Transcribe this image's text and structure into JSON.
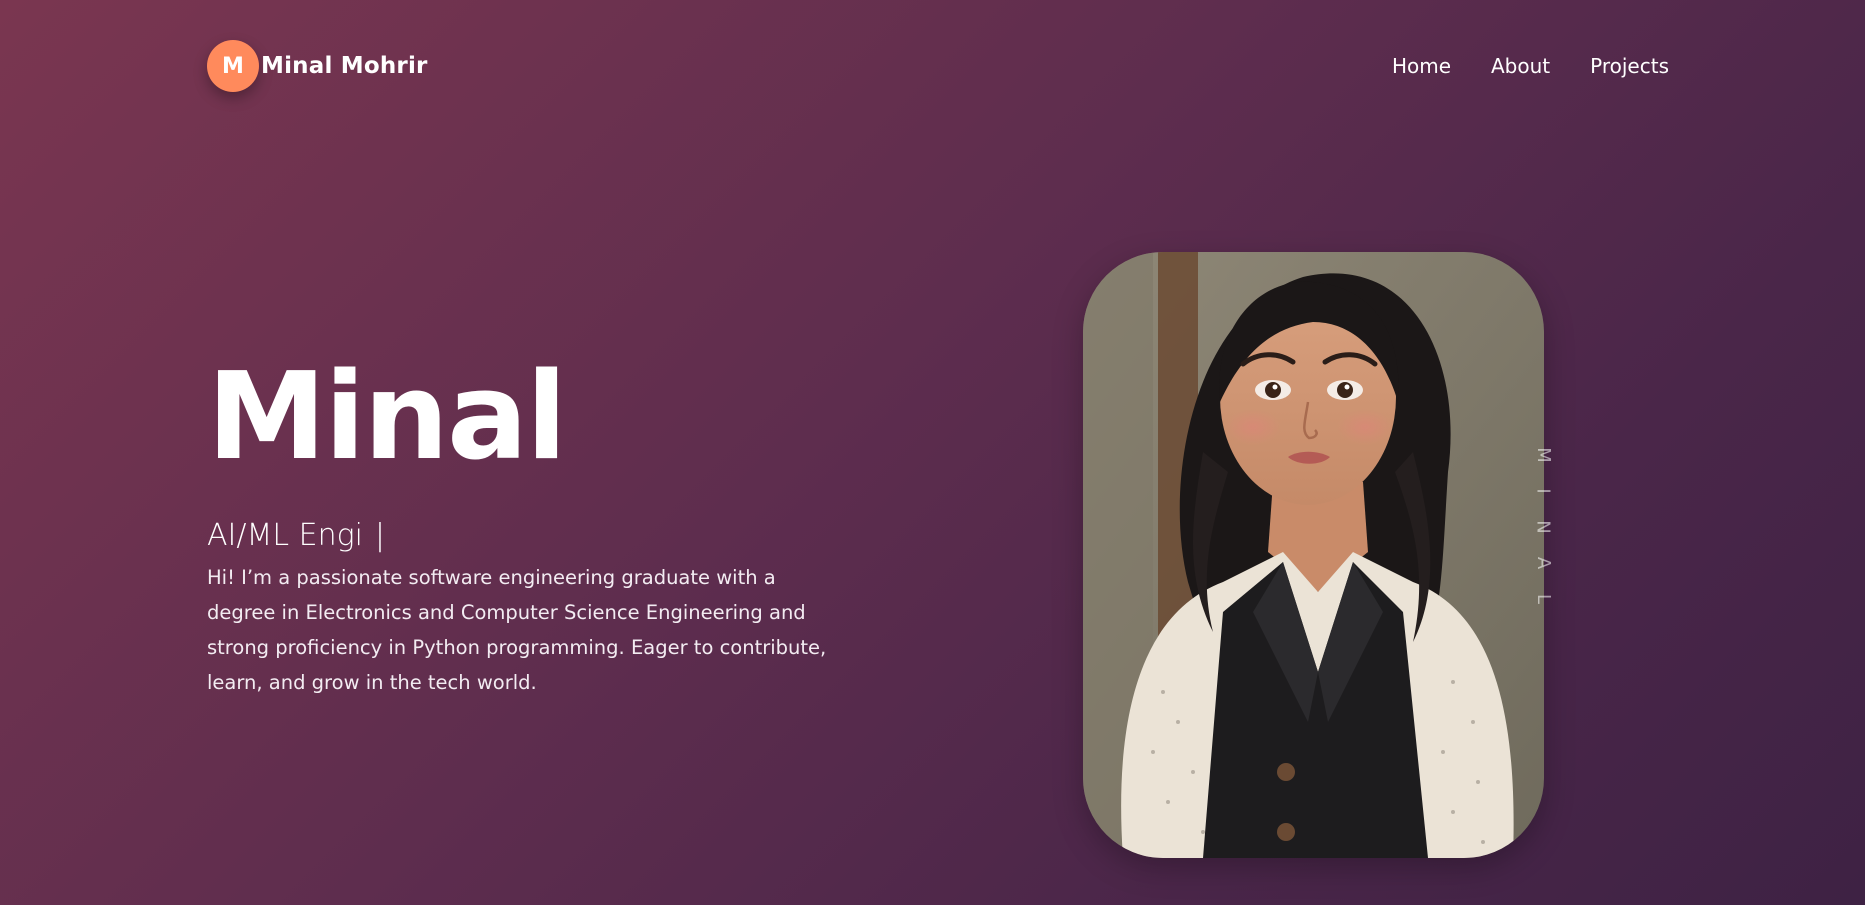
{
  "header": {
    "logo_letter": "M",
    "brand_name": "Minal Mohrir",
    "nav": [
      {
        "label": "Home"
      },
      {
        "label": "About"
      },
      {
        "label": "Projects"
      }
    ]
  },
  "hero": {
    "name": "Minal",
    "role_typed": "AI/ML Engi",
    "cursor": "|",
    "bio": "Hi! I’m a passionate software engineering graduate with a degree in Electronics and Computer Science Engineering and strong proficiency in Python programming. Eager to contribute, learn, and grow in the tech world."
  },
  "portrait": {
    "alt": "Portrait of Minal",
    "vertical_letters": [
      "M",
      "I",
      "N",
      "A",
      "L"
    ]
  },
  "colors": {
    "accent": "#ff8a5c",
    "background_start": "#7a3650",
    "background_end": "#3e2244"
  }
}
